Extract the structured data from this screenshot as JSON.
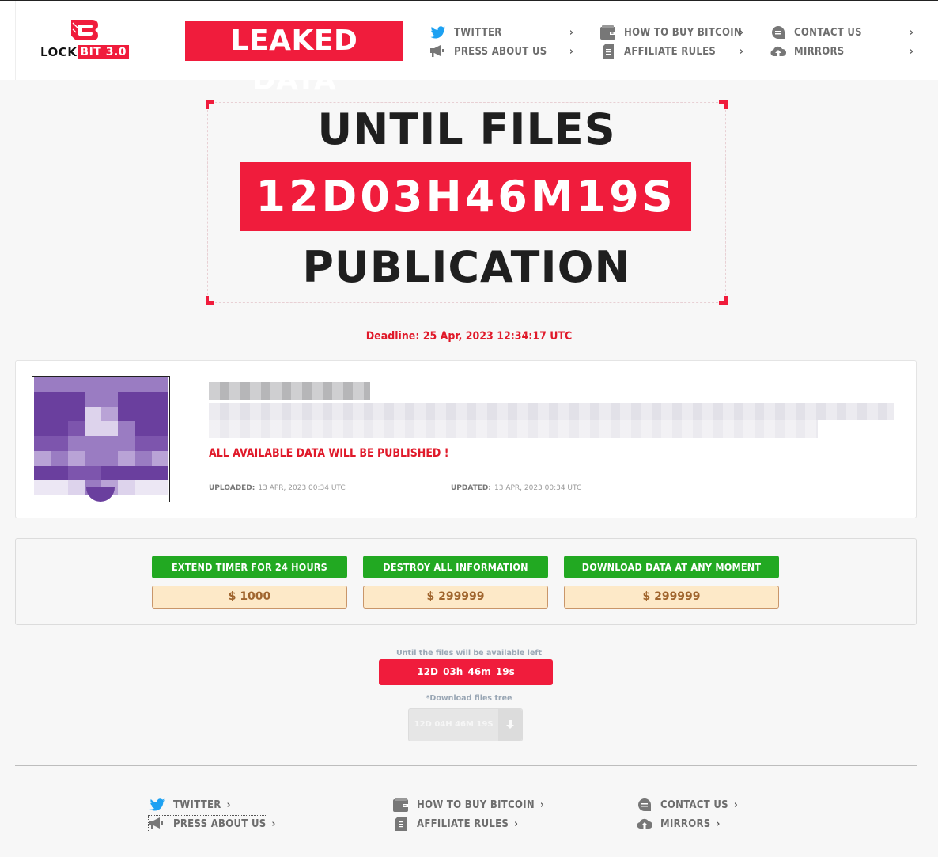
{
  "brand": {
    "logo_word": "LOCK",
    "logo_badge": "BIT 3.0",
    "page_title": "LEAKED DATA",
    "accent_color": "#f01c3c",
    "button_green": "#22a922"
  },
  "nav": {
    "items": [
      {
        "label": "TWITTER",
        "icon": "twitter-icon"
      },
      {
        "label": "PRESS ABOUT US",
        "icon": "megaphone-icon"
      },
      {
        "label": "HOW TO BUY BITCOIN",
        "icon": "wallet-icon"
      },
      {
        "label": "AFFILIATE RULES",
        "icon": "document-icon"
      },
      {
        "label": "CONTACT US",
        "icon": "chat-icon"
      },
      {
        "label": "MIRRORS",
        "icon": "cloud-upload-icon"
      }
    ],
    "chevron": "›"
  },
  "countdown": {
    "line_top": "UNTIL FILES",
    "timer": "12D03H46M19S",
    "line_bottom": "PUBLICATION",
    "deadline": "Deadline: 25 Apr, 2023 12:34:17 UTC"
  },
  "post": {
    "title_redacted": true,
    "description_redacted": true,
    "warning": "ALL AVAILABLE DATA WILL BE PUBLISHED !",
    "uploaded_label": "UPLOADED:",
    "uploaded_value": "13 APR, 2023 00:34 UTC",
    "updated_label": "UPDATED:",
    "updated_value": "13 APR, 2023 00:34 UTC"
  },
  "actions": [
    {
      "label": "EXTEND TIMER FOR 24 HOURS",
      "price": "$ 1000"
    },
    {
      "label": "DESTROY ALL INFORMATION",
      "price": "$ 299999"
    },
    {
      "label": "DOWNLOAD DATA AT ANY MOMENT",
      "price": "$ 299999"
    }
  ],
  "availability": {
    "label": "Until the files will be available left",
    "timer": "12D 03h 46m 19s",
    "tree_label": "*Download files tree",
    "tree_timer": "12D 04H 46M 19S"
  },
  "footer": {
    "items": [
      {
        "label": "TWITTER",
        "icon": "twitter-icon"
      },
      {
        "label": "PRESS ABOUT US",
        "icon": "megaphone-icon"
      },
      {
        "label": "HOW TO BUY BITCOIN",
        "icon": "wallet-icon"
      },
      {
        "label": "AFFILIATE RULES",
        "icon": "document-icon"
      },
      {
        "label": "CONTACT US",
        "icon": "chat-icon"
      },
      {
        "label": "MIRRORS",
        "icon": "cloud-upload-icon"
      }
    ],
    "chevron": "›"
  }
}
